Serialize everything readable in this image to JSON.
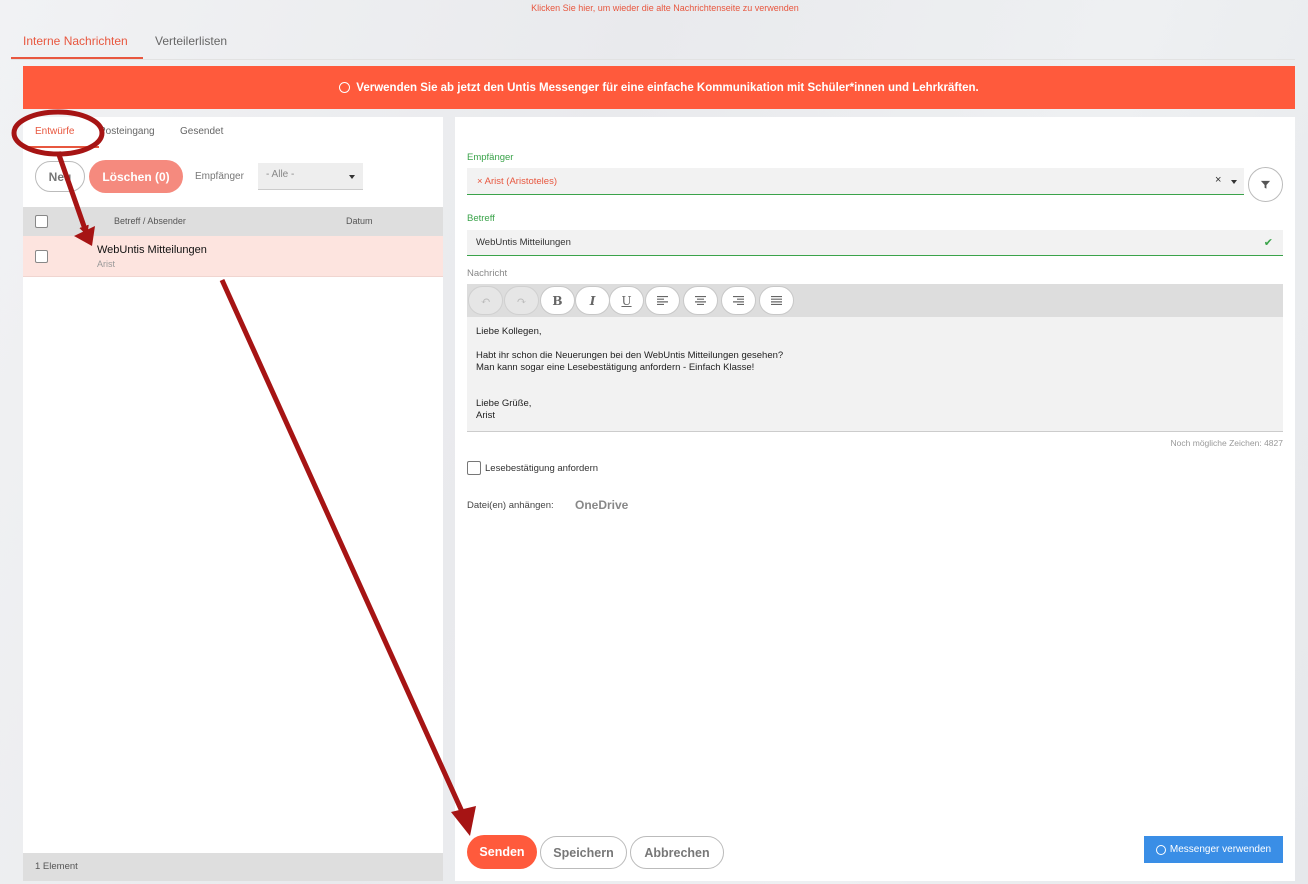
{
  "top_link": "Klicken Sie hier, um wieder die alte Nachrichtenseite zu verwenden",
  "main_tabs": [
    {
      "label": "Interne Nachrichten",
      "active": true
    },
    {
      "label": "Verteilerlisten",
      "active": false
    }
  ],
  "banner": {
    "text": "Verwenden Sie ab jetzt den Untis Messenger für eine einfache Kommunikation mit Schüler*innen und Lehrkräften.",
    "color": "#ff5a3c"
  },
  "left": {
    "sub_tabs": [
      {
        "label": "Entwürfe",
        "active": true
      },
      {
        "label": "Posteingang",
        "active": false
      },
      {
        "label": "Gesendet",
        "active": false
      }
    ],
    "new_button": "Neu",
    "delete_button": "Löschen (0)",
    "recipient_filter_label": "Empfänger",
    "recipient_filter_value": "- Alle -",
    "columns": {
      "subject": "Betreff / Absender",
      "date": "Datum"
    },
    "rows": [
      {
        "title": "WebUntis Mitteilungen",
        "sender": "Arist",
        "date": ""
      }
    ],
    "footer": "1 Element"
  },
  "right": {
    "recipient_label": "Empfänger",
    "recipient_chip": "Arist (Aristoteles)",
    "subject_label": "Betreff",
    "subject_value": "WebUntis Mitteilungen",
    "message_label": "Nachricht",
    "toolbar_icons": [
      "undo-icon",
      "redo-icon",
      "bold-icon",
      "italic-icon",
      "underline-icon",
      "align-left-icon",
      "align-center-icon",
      "align-right-icon",
      "justify-icon"
    ],
    "toolbar_glyphs": {
      "bold": "B",
      "italic": "I",
      "underline": "U"
    },
    "message_lines": [
      "Liebe Kollegen,",
      "",
      "Habt ihr schon die Neuerungen bei den WebUntis Mitteilungen gesehen?",
      "Man kann sogar eine Lesebestätigung anfordern - Einfach Klasse!",
      "",
      "",
      "Liebe Grüße,",
      "Arist"
    ],
    "chars_remaining": "Noch mögliche Zeichen: 4827",
    "read_receipt_label": "Lesebestätigung anfordern",
    "attach_label": "Datei(en) anhängen:",
    "attach_onedrive": "OneDrive",
    "send_button": "Senden",
    "save_button": "Speichern",
    "cancel_button": "Abbrechen",
    "messenger_button": "Messenger verwenden"
  },
  "colors": {
    "accent": "#e8573f",
    "valid": "#3aa34a",
    "messenger_blue": "#3a8ee6",
    "annotation": "#a61414"
  }
}
